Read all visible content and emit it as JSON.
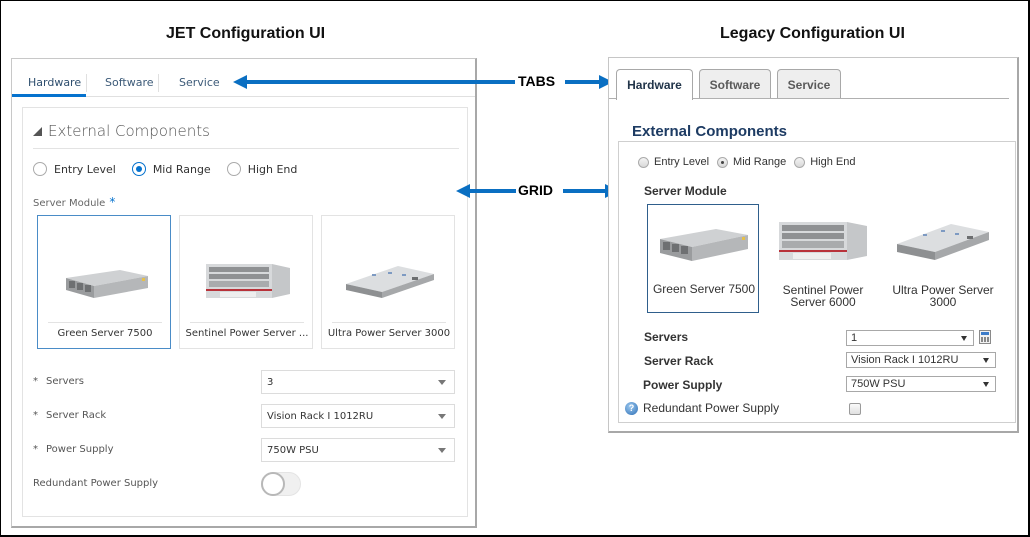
{
  "captions": {
    "jet": "JET Configuration UI",
    "legacy": "Legacy Configuration UI"
  },
  "annotations": {
    "tabs": "TABS",
    "grid": "GRID",
    "arrow_color": "#0a6fc2"
  },
  "jet": {
    "tabs": [
      {
        "label": "Hardware",
        "active": true
      },
      {
        "label": "Software",
        "active": false
      },
      {
        "label": "Service",
        "active": false
      }
    ],
    "section_title": "External Components",
    "tier_options": [
      {
        "label": "Entry Level",
        "selected": false
      },
      {
        "label": "Mid Range",
        "selected": true
      },
      {
        "label": "High End",
        "selected": false
      }
    ],
    "server_module_label": "Server Module",
    "required_marker": "*",
    "server_modules": [
      {
        "name": "Green Server 7500",
        "icon": "server-1u-icon",
        "selected": true
      },
      {
        "name": "Sentinel Power Server ...",
        "icon": "server-4u-icon",
        "selected": false
      },
      {
        "name": "Ultra Power Server 3000",
        "icon": "server-blade-icon",
        "selected": false
      }
    ],
    "fields": [
      {
        "label": "Servers",
        "value": "3",
        "required": true
      },
      {
        "label": "Server Rack",
        "value": "Vision Rack I 1012RU",
        "required": true
      },
      {
        "label": "Power Supply",
        "value": "750W PSU",
        "required": true
      }
    ],
    "redundant_label": "Redundant Power Supply",
    "redundant_on": false,
    "accent": "#0572ce"
  },
  "legacy": {
    "tabs": [
      {
        "label": "Hardware",
        "active": true
      },
      {
        "label": "Software",
        "active": false
      },
      {
        "label": "Service",
        "active": false
      }
    ],
    "section_title": "External Components",
    "tier_options": [
      {
        "label": "Entry Level",
        "selected": false
      },
      {
        "label": "Mid Range",
        "selected": true
      },
      {
        "label": "High End",
        "selected": false
      }
    ],
    "server_module_label": "Server Module",
    "server_modules": [
      {
        "name": "Green Server 7500",
        "icon": "server-1u-icon",
        "selected": true
      },
      {
        "name": "Sentinel Power Server 6000",
        "icon": "server-4u-icon",
        "selected": false
      },
      {
        "name": "Ultra Power Server 3000",
        "icon": "server-blade-icon",
        "selected": false
      }
    ],
    "fields": [
      {
        "label": "Servers",
        "value": "1"
      },
      {
        "label": "Server Rack",
        "value": "Vision Rack I 1012RU"
      },
      {
        "label": "Power Supply",
        "value": "750W PSU"
      }
    ],
    "calculator_icon": "calculator-icon",
    "help_icon_glyph": "?",
    "redundant_label": "Redundant Power Supply",
    "redundant_checked": false,
    "title_color": "#1d3b63"
  }
}
